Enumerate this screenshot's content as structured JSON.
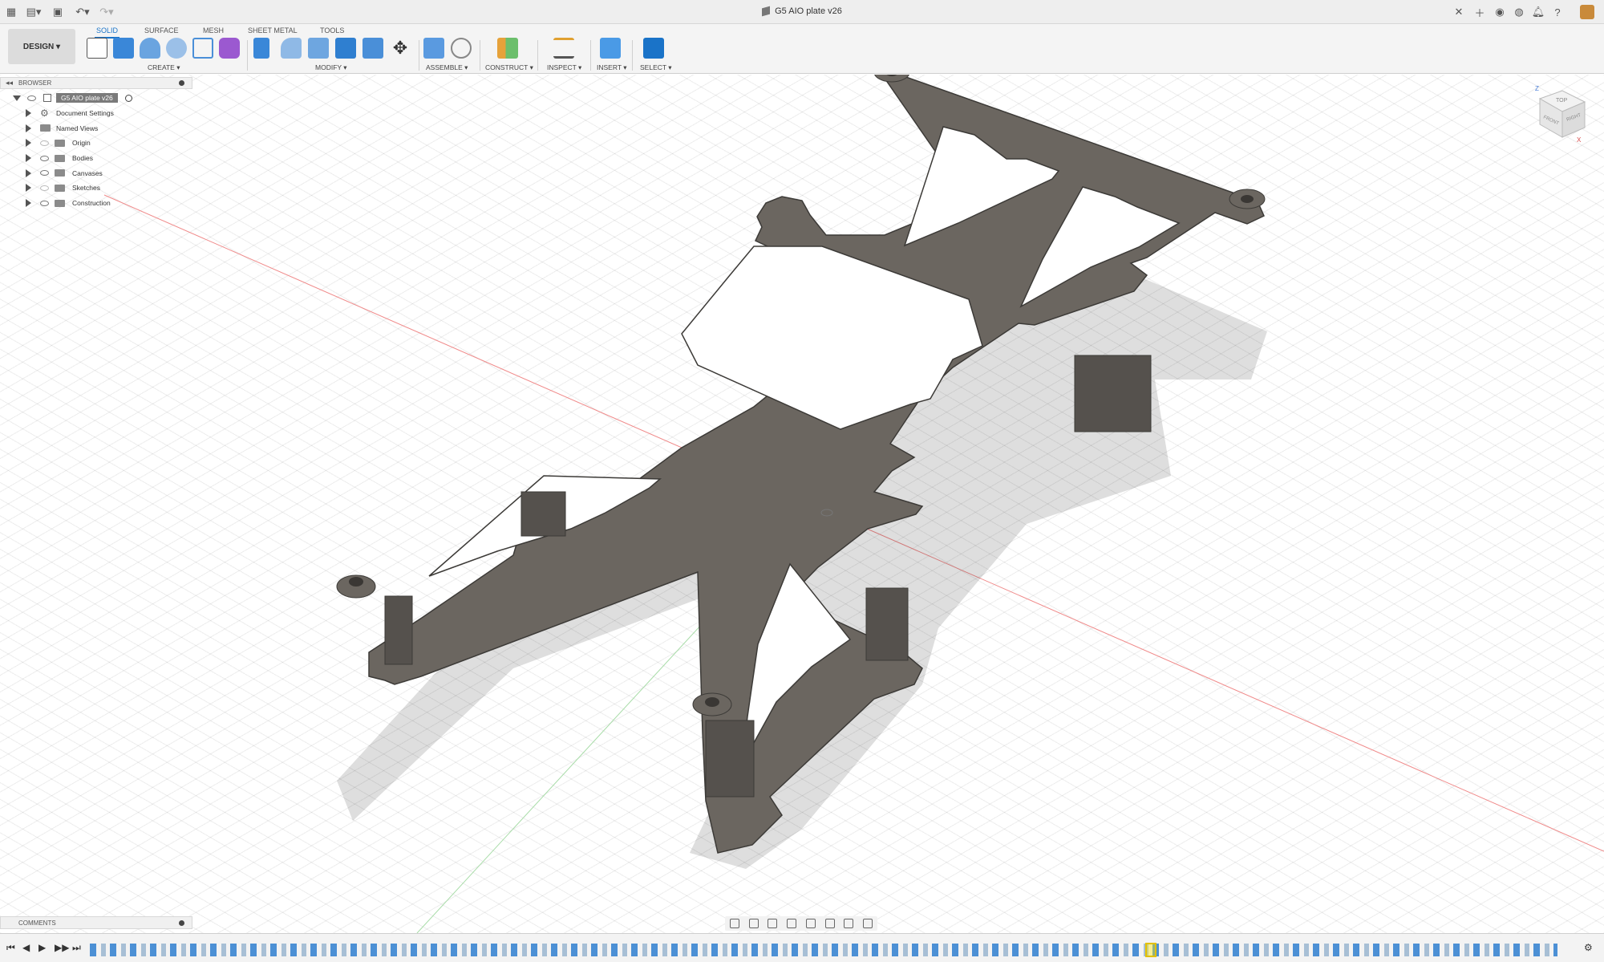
{
  "titlebar": {
    "document_title": "G5 AIO plate v26",
    "icons": [
      "grid-icon",
      "file-icon",
      "save-icon",
      "undo-icon",
      "redo-icon"
    ],
    "right_icons": [
      "close-tab-icon",
      "new-tab-icon",
      "online-icon",
      "job-status-icon",
      "notifications-icon",
      "help-icon",
      "user-avatar"
    ]
  },
  "ribbon": {
    "workspace_button": "DESIGN ▾",
    "tabs": [
      {
        "label": "SOLID",
        "active": true
      },
      {
        "label": "SURFACE",
        "active": false
      },
      {
        "label": "MESH",
        "active": false
      },
      {
        "label": "SHEET METAL",
        "active": false
      },
      {
        "label": "TOOLS",
        "active": false
      }
    ],
    "groups": {
      "create": "CREATE ▾",
      "modify": "MODIFY ▾",
      "assemble": "ASSEMBLE ▾",
      "construct": "CONSTRUCT ▾",
      "inspect": "INSPECT ▾",
      "insert": "INSERT ▾",
      "select": "SELECT ▾"
    },
    "accent": "#1a73c8"
  },
  "browser": {
    "header": "BROWSER",
    "root": "G5 AIO plate v26",
    "items": [
      {
        "label": "Document Settings",
        "icon": "gear-icon"
      },
      {
        "label": "Named Views",
        "icon": "folder-icon"
      },
      {
        "label": "Origin",
        "icon": "folder-icon"
      },
      {
        "label": "Bodies",
        "icon": "folder-icon"
      },
      {
        "label": "Canvases",
        "icon": "folder-icon"
      },
      {
        "label": "Sketches",
        "icon": "folder-icon"
      },
      {
        "label": "Construction",
        "icon": "folder-icon"
      }
    ]
  },
  "viewcube": {
    "top": "TOP",
    "front": "FRONT",
    "right": "RIGHT",
    "axes": [
      "Z",
      "X"
    ]
  },
  "comments": {
    "header": "COMMENTS"
  },
  "colors": {
    "model": "#6b6660",
    "model_dark": "#4a4642",
    "grid": "#e3e3e3",
    "x_axis": "#f08a8a",
    "y_axis": "#9fd99f"
  }
}
